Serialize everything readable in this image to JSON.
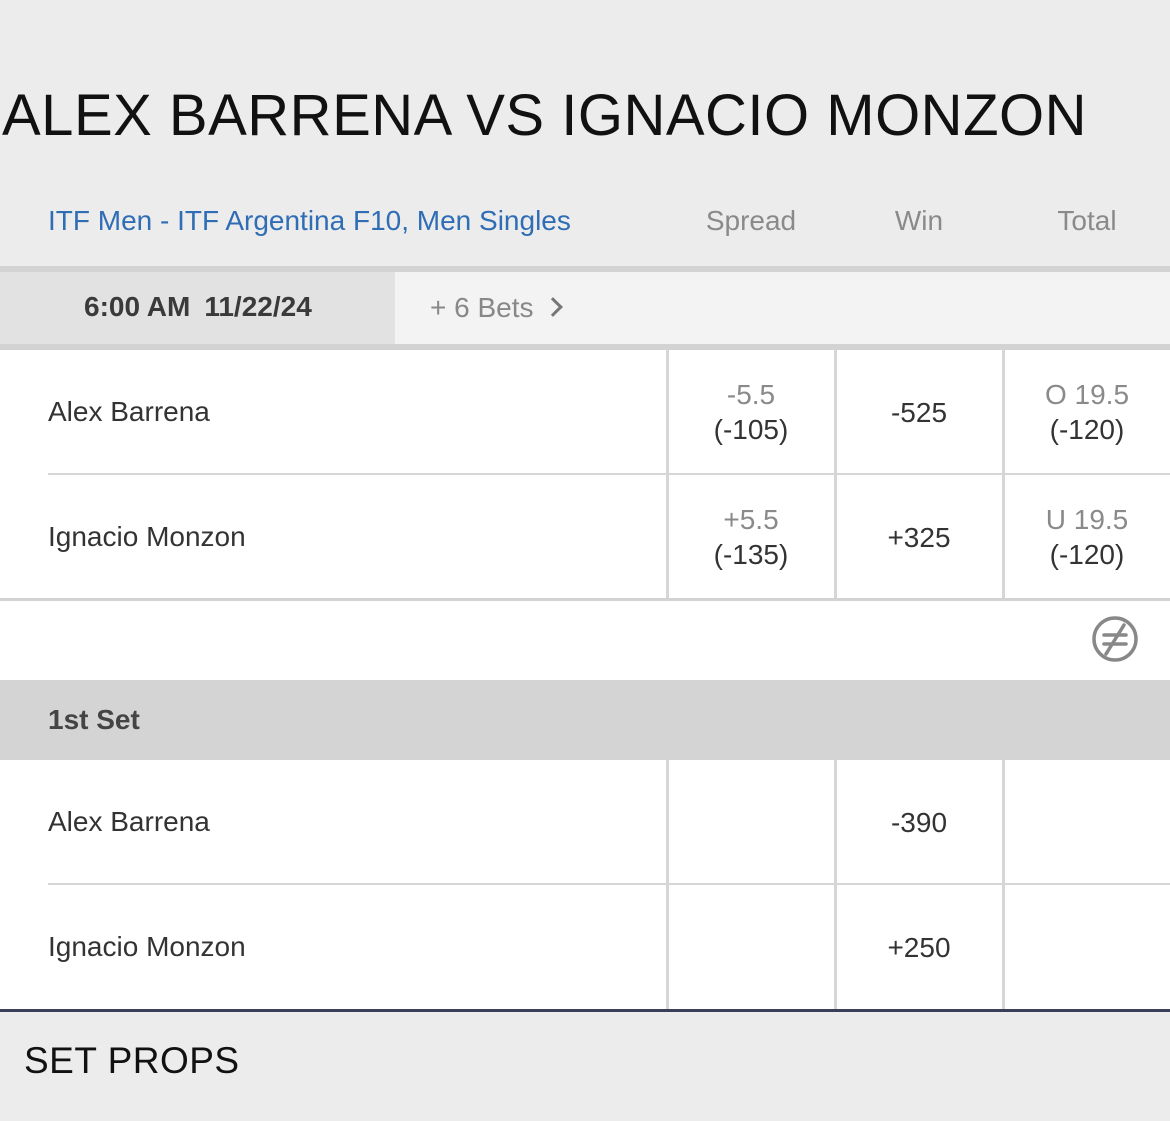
{
  "match": {
    "title": "ALEX BARRENA VS IGNACIO MONZON"
  },
  "header": {
    "league": "ITF Men - ITF Argentina F10, Men Singles",
    "columns": {
      "spread": "Spread",
      "win": "Win",
      "total": "Total"
    }
  },
  "event": {
    "time": "6:00 AM",
    "date": "11/22/24",
    "more_bets": "+ 6 Bets"
  },
  "main_market": {
    "rows": [
      {
        "player": "Alex Barrena",
        "spread_line": "-5.5",
        "spread_odds": "(-105)",
        "win": "-525",
        "total_line": "O 19.5",
        "total_odds": "(-120)"
      },
      {
        "player": "Ignacio Monzon",
        "spread_line": "+5.5",
        "spread_odds": "(-135)",
        "win": "+325",
        "total_line": "U 19.5",
        "total_odds": "(-120)"
      }
    ]
  },
  "set_market": {
    "title": "1st Set",
    "rows": [
      {
        "player": "Alex Barrena",
        "win": "-390"
      },
      {
        "player": "Ignacio Monzon",
        "win": "+250"
      }
    ]
  },
  "set_props": {
    "title": "SET PROPS"
  },
  "icons": {
    "chevron": "chevron-right-icon",
    "compare": "not-equal-icon"
  },
  "colors": {
    "link": "#2f6db5",
    "muted": "#8a8a8a",
    "background": "#ececec",
    "section": "#d4d4d4",
    "bottom_rule": "#3c3f58"
  }
}
